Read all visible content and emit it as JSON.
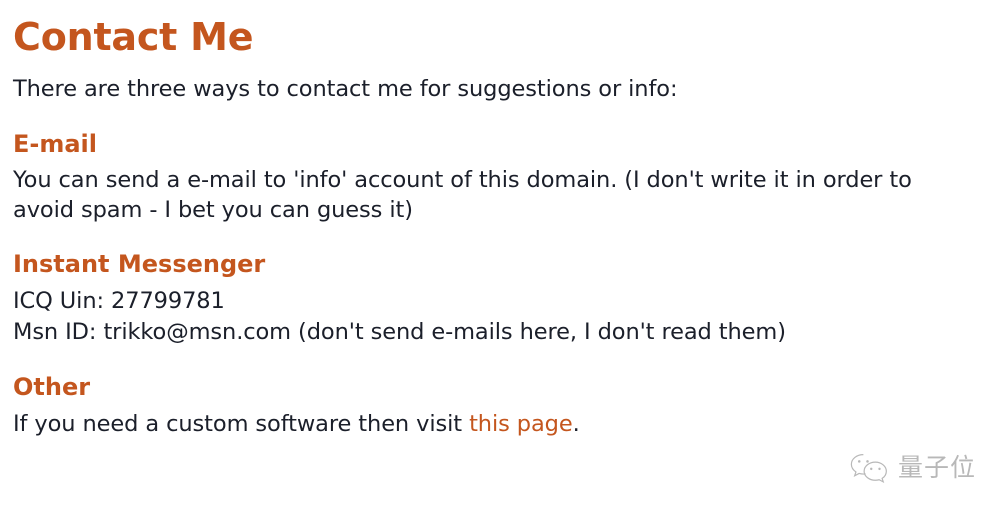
{
  "page": {
    "title": "Contact Me",
    "intro": "There are three ways to contact me for suggestions or info:",
    "colors": {
      "heading": "#c4561e",
      "body_text": "#1b1f2a",
      "link": "#c4561e",
      "background": "#ffffff",
      "watermark": "#8d8d8d"
    }
  },
  "sections": {
    "email": {
      "heading": "E-mail",
      "text": "You can send a e-mail to 'info' account of this domain. (I don't write it in order to avoid spam - I bet you can guess it)"
    },
    "instant_messenger": {
      "heading": "Instant Messenger",
      "icq_line": "ICQ Uin: 27799781",
      "msn_line": "Msn ID: trikko@msn.com (don't send e-mails here, I don't read them)"
    },
    "other": {
      "heading": "Other",
      "text_before_link": "If you need a custom software then visit ",
      "link_text": "this page",
      "text_after_link": "."
    }
  },
  "watermark": {
    "icon": "wechat-icon",
    "text": "量子位"
  }
}
